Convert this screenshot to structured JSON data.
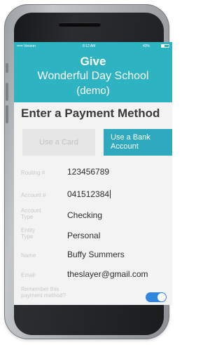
{
  "status_bar": {
    "carrier": "••••• Verizon",
    "time": "8:12 AM",
    "battery": "43%",
    "battery_level": 0.43
  },
  "header": {
    "line1": "Give",
    "line2": "Wonderful Day School",
    "line3": "(demo)"
  },
  "page_title": "Enter a Payment Method",
  "tabs": {
    "card_label": "Use a Card",
    "bank_label_1": "Use a Bank",
    "bank_label_2": "Account"
  },
  "form": {
    "routing": {
      "label": "Routing #",
      "value": "123456789"
    },
    "account": {
      "label": "Account #",
      "value": "041512384"
    },
    "account_type": {
      "label_1": "Account",
      "label_2": "Type",
      "value": "Checking"
    },
    "entity_type": {
      "label_1": "Entity",
      "label_2": "Type",
      "value": "Personal"
    },
    "name": {
      "label": "Name",
      "value": "Buffy Summers"
    },
    "email": {
      "label": "Email",
      "value": "theslayer@gmail.com"
    },
    "remember": {
      "label_1": "Remember this",
      "label_2": "payment method?",
      "enabled": true
    }
  },
  "colors": {
    "brand": "#2eb3c3",
    "tab_active": "#2ea9be",
    "toggle_on": "#2e86e0"
  }
}
